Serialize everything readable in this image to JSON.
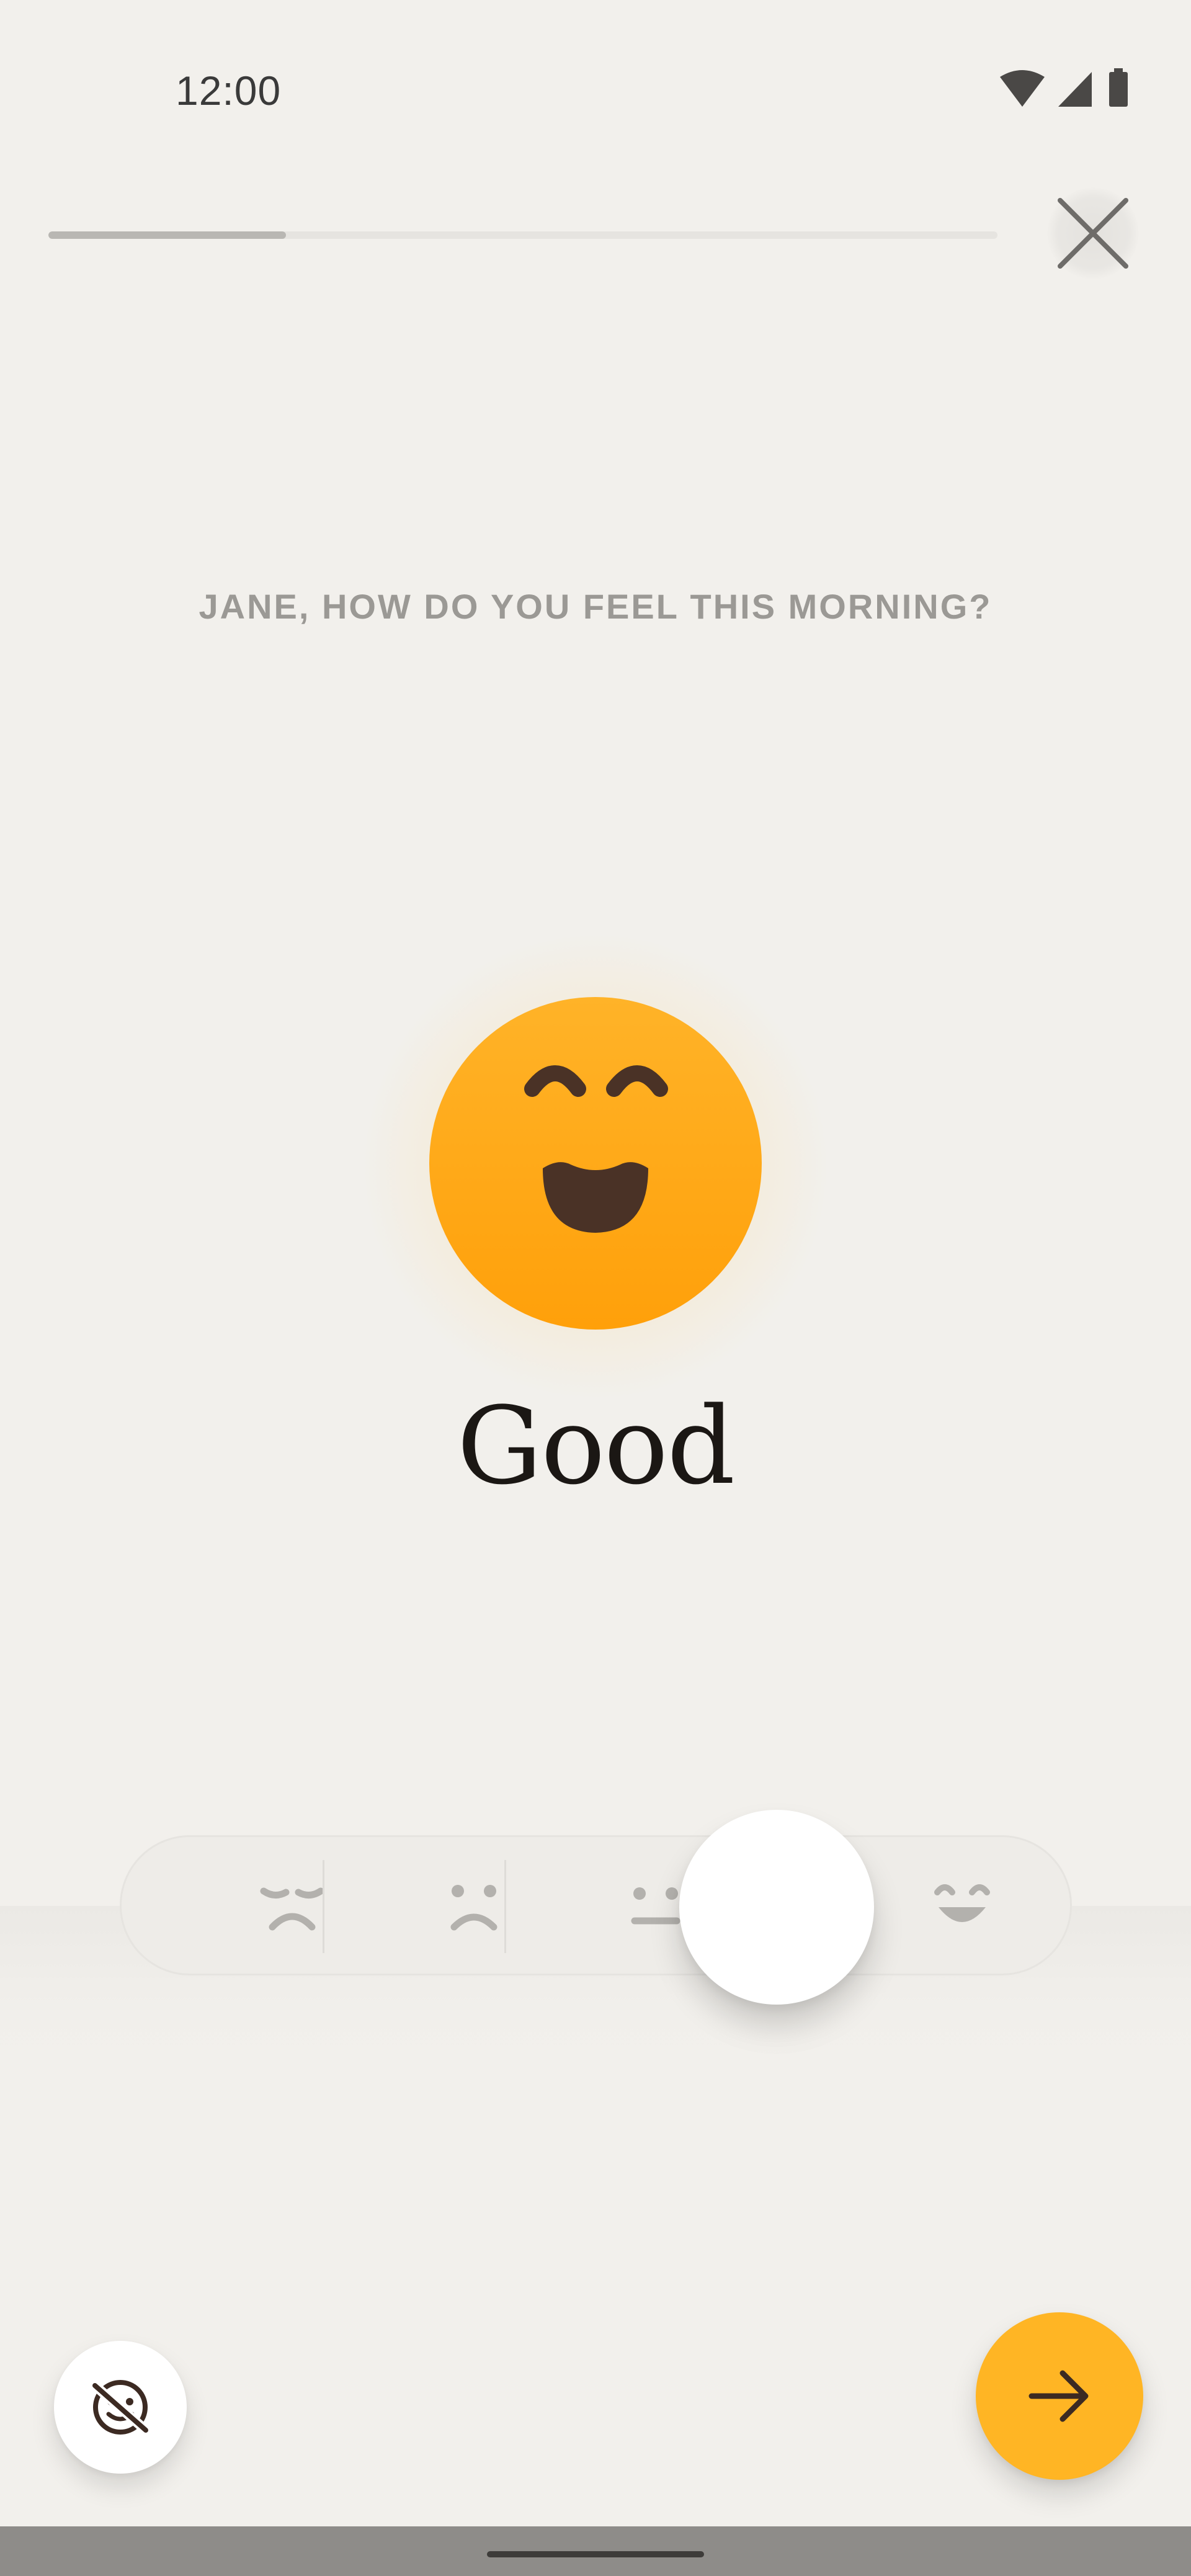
{
  "status_bar": {
    "time": "12:00",
    "icons": [
      "wifi-icon",
      "cellular-signal-icon",
      "battery-icon"
    ]
  },
  "header": {
    "progress": 0.25,
    "close_icon": "close-icon"
  },
  "question": "JANE, HOW DO YOU FEEL THIS MORNING?",
  "mood": {
    "label": "Good",
    "icon": "happy-face-icon",
    "color": "#ffa817"
  },
  "scale": {
    "options": [
      "very-sad-face-icon",
      "sad-face-icon",
      "neutral-face-icon",
      "good-face-icon",
      "happy-face-icon"
    ],
    "selected_index": 3
  },
  "footer": {
    "hide_icon": "hide-icon",
    "next_icon": "arrow-right-icon",
    "accent": "#ffb524"
  }
}
